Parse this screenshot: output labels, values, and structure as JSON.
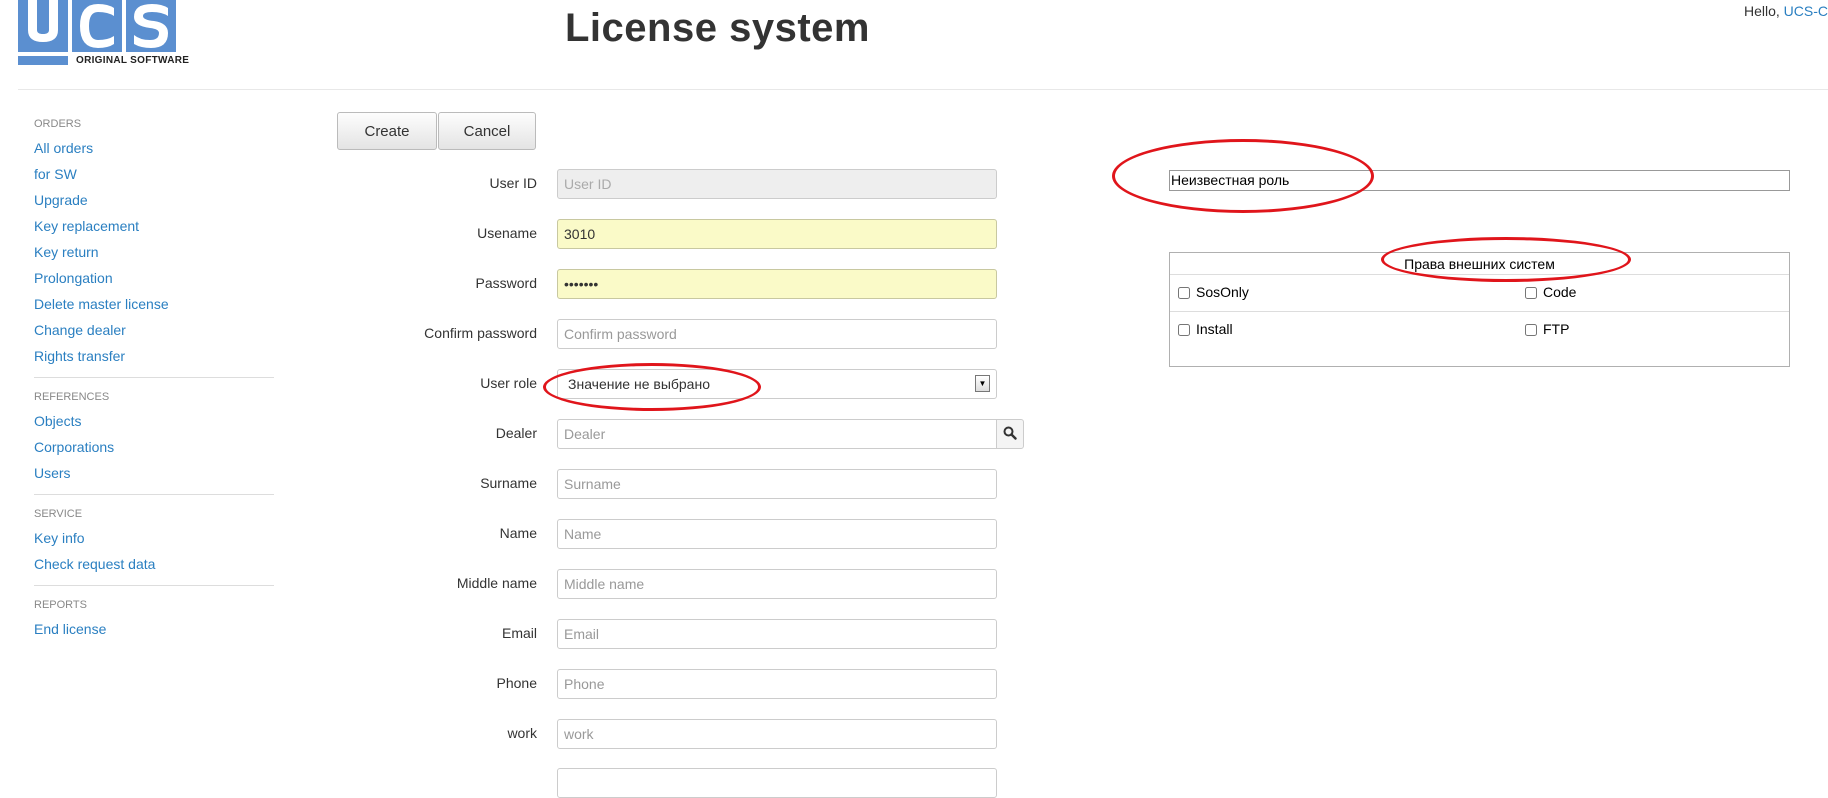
{
  "header": {
    "logo_text": "UCS",
    "logo_tagline": "ORIGINAL SOFTWARE",
    "title": "License system",
    "greeting": "Hello, ",
    "user_link": "UCS-C"
  },
  "colors": {
    "link": "#2a7fc1",
    "logo_blue": "#5b8fd0",
    "annotation_red": "#e0151b",
    "autofill_bg": "#fafac8"
  },
  "sidebar": {
    "groups": [
      {
        "heading": "ORDERS",
        "items": [
          "All orders",
          "for SW",
          "Upgrade",
          "Key replacement",
          "Key return",
          "Prolongation",
          "Delete master license",
          "Change dealer",
          "Rights transfer"
        ]
      },
      {
        "heading": "REFERENCES",
        "items": [
          "Objects",
          "Corporations",
          "Users"
        ]
      },
      {
        "heading": "SERVICE",
        "items": [
          "Key info",
          "Check request data"
        ]
      },
      {
        "heading": "REPORTS",
        "items": [
          "End license"
        ]
      }
    ]
  },
  "toolbar": {
    "create_label": "Create",
    "cancel_label": "Cancel"
  },
  "form": {
    "user_id": {
      "label": "User ID",
      "value": "",
      "placeholder": "User ID"
    },
    "username": {
      "label": "Usename",
      "value": "3010",
      "placeholder": ""
    },
    "password": {
      "label": "Password",
      "value": "•••••••",
      "placeholder": ""
    },
    "confirm_password": {
      "label": "Confirm password",
      "value": "",
      "placeholder": "Confirm password"
    },
    "user_role": {
      "label": "User role",
      "selected": "Значение не выбрано"
    },
    "dealer": {
      "label": "Dealer",
      "value": "",
      "placeholder": "Dealer",
      "button_icon": "search-icon"
    },
    "surname": {
      "label": "Surname",
      "value": "",
      "placeholder": "Surname"
    },
    "name": {
      "label": "Name",
      "value": "",
      "placeholder": "Name"
    },
    "middle_name": {
      "label": "Middle name",
      "value": "",
      "placeholder": "Middle name"
    },
    "email": {
      "label": "Email",
      "value": "",
      "placeholder": "Email"
    },
    "phone": {
      "label": "Phone",
      "value": "",
      "placeholder": "Phone"
    },
    "work": {
      "label": "work",
      "value": "",
      "placeholder": "work"
    }
  },
  "role_panel": {
    "role_text": "Неизвестная роль"
  },
  "rights_panel": {
    "title": "Права внешних систем",
    "checkboxes": [
      {
        "label": "SosOnly",
        "checked": false
      },
      {
        "label": "Code",
        "checked": false
      },
      {
        "label": "Install",
        "checked": false
      },
      {
        "label": "FTP",
        "checked": false
      }
    ]
  }
}
